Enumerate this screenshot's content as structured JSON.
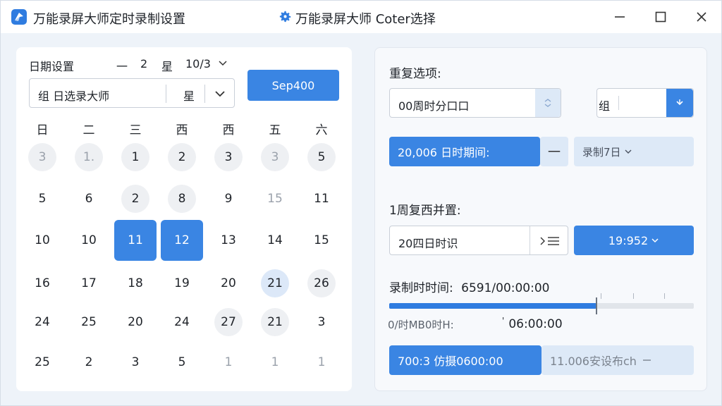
{
  "window": {
    "title": "万能录屏大师定时录制设置",
    "center_title": "万能录屏大师 Coter选择",
    "accent": "#3a85e3"
  },
  "icons": {
    "logo": "app-logo-icon",
    "settings": "gear-icon",
    "minimize": "minimize-icon",
    "maximize": "maximize-icon",
    "close": "close-icon"
  },
  "left": {
    "header_label": "日期设置",
    "header_values": [
      "一",
      "2",
      "星",
      "10/3"
    ],
    "search_text": "组 日选录大师",
    "search_mid": "星",
    "primary_button": "Sep400",
    "weekdays": [
      "日",
      "二",
      "三",
      "西",
      "西",
      "五",
      "六"
    ],
    "days": [
      [
        {
          "t": "3",
          "s": "muted-circ"
        },
        {
          "t": "1.",
          "s": "muted-circ"
        },
        {
          "t": "1",
          "s": "circ"
        },
        {
          "t": "2",
          "s": "circ"
        },
        {
          "t": "3",
          "s": "circ"
        },
        {
          "t": "3",
          "s": "muted-circ"
        },
        {
          "t": "5",
          "s": "circ"
        }
      ],
      [
        {
          "t": "5",
          "s": ""
        },
        {
          "t": "6",
          "s": ""
        },
        {
          "t": "2",
          "s": "circ"
        },
        {
          "t": "8",
          "s": "circ"
        },
        {
          "t": "9",
          "s": ""
        },
        {
          "t": "15",
          "s": "muted"
        },
        {
          "t": "11",
          "s": ""
        }
      ],
      [
        {
          "t": "10",
          "s": ""
        },
        {
          "t": "10",
          "s": ""
        },
        {
          "t": "11",
          "s": "sel"
        },
        {
          "t": "12",
          "s": "sel"
        },
        {
          "t": "13",
          "s": ""
        },
        {
          "t": "14",
          "s": ""
        },
        {
          "t": "15",
          "s": ""
        }
      ],
      [
        {
          "t": "16",
          "s": ""
        },
        {
          "t": "17",
          "s": ""
        },
        {
          "t": "18",
          "s": ""
        },
        {
          "t": "19",
          "s": ""
        },
        {
          "t": "20",
          "s": ""
        },
        {
          "t": "21",
          "s": "light"
        },
        {
          "t": "26",
          "s": "circ"
        }
      ],
      [
        {
          "t": "24",
          "s": ""
        },
        {
          "t": "25",
          "s": ""
        },
        {
          "t": "20",
          "s": ""
        },
        {
          "t": "24",
          "s": ""
        },
        {
          "t": "27",
          "s": "circ"
        },
        {
          "t": "21",
          "s": "circ"
        },
        {
          "t": "3",
          "s": ""
        }
      ],
      [
        {
          "t": "25",
          "s": ""
        },
        {
          "t": "2",
          "s": ""
        },
        {
          "t": "3",
          "s": ""
        },
        {
          "t": "5",
          "s": ""
        },
        {
          "t": "1",
          "s": "muted"
        },
        {
          "t": "1",
          "s": "muted"
        },
        {
          "t": "1",
          "s": "muted"
        }
      ]
    ]
  },
  "right": {
    "repeat_label": "重复选项:",
    "repeat_input": "00周时分口口",
    "small_input": "组",
    "range_value": "20,006 日时期间:",
    "range_minus": "一",
    "record_select": "录制7日",
    "section2_label": "1周复西并置:",
    "time_input": "20四日时识",
    "time_time_select": "19:952",
    "record_time_label": "录制时时间:",
    "record_time_value": "6591/00:00:00",
    "progress": 0.68,
    "meta_left": "0/时MB0时H:",
    "meta_right": "06:00:00",
    "bottom_blue": "700:3 仿摄0600:00",
    "bottom_pale": "11.006安设布ch"
  }
}
